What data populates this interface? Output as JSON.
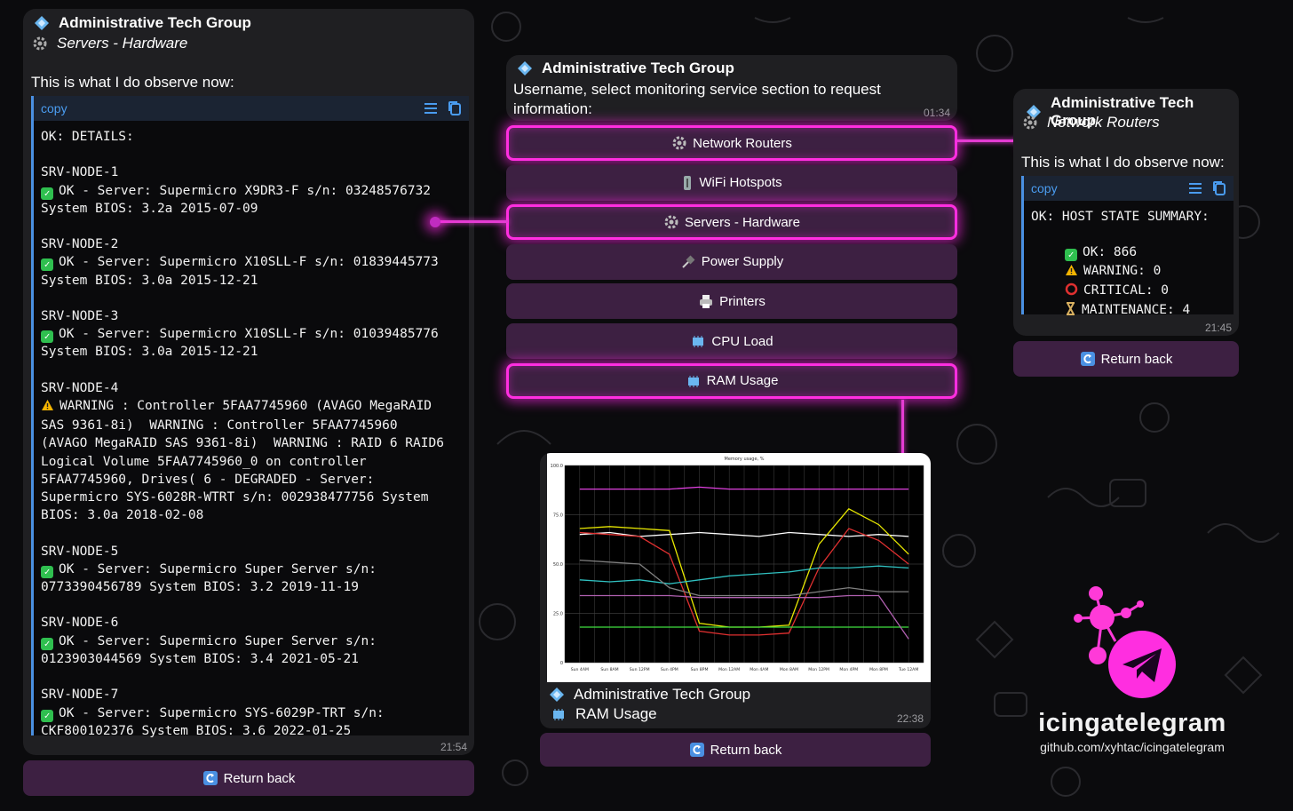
{
  "colors": {
    "accent_glow": "#ff2ee0",
    "keyboard_btn": "#3d2042",
    "bubble": "#1f1f22",
    "code_border": "#4a90e2",
    "check": "#2fbf4f"
  },
  "left_msg": {
    "group": "Administrative Tech Group",
    "section": "Servers - Hardware",
    "intro": "This is what I do observe now:",
    "code_copy": "copy",
    "lines": [
      {
        "t": "OK: DETAILS:"
      },
      {
        "t": ""
      },
      {
        "t": "SRV-NODE-1"
      },
      {
        "icon": "check",
        "t": "OK - Server: Supermicro X9DR3-F s/n: 03248576732"
      },
      {
        "t": "System BIOS: 3.2a 2015-07-09"
      },
      {
        "t": ""
      },
      {
        "t": "SRV-NODE-2"
      },
      {
        "icon": "check",
        "t": "OK - Server: Supermicro X10SLL-F s/n: 01839445773"
      },
      {
        "t": "System BIOS: 3.0a 2015-12-21"
      },
      {
        "t": ""
      },
      {
        "t": "SRV-NODE-3"
      },
      {
        "icon": "check",
        "t": "OK - Server: Supermicro X10SLL-F s/n: 01039485776"
      },
      {
        "t": "System BIOS: 3.0a 2015-12-21"
      },
      {
        "t": ""
      },
      {
        "t": "SRV-NODE-4"
      },
      {
        "icon": "warn",
        "t": "WARNING : Controller 5FAA7745960 (AVAGO MegaRAID"
      },
      {
        "t": "SAS 9361-8i)  WARNING : Controller 5FAA7745960"
      },
      {
        "t": "(AVAGO MegaRAID SAS 9361-8i)  WARNING : RAID 6 RAID6"
      },
      {
        "t": "Logical Volume 5FAA7745960_0 on controller"
      },
      {
        "t": "5FAA7745960, Drives( 6 - DEGRADED - Server:"
      },
      {
        "t": "Supermicro SYS-6028R-WTRT s/n: 002938477756 System"
      },
      {
        "t": "BIOS: 3.0a 2018-02-08"
      },
      {
        "t": ""
      },
      {
        "t": "SRV-NODE-5"
      },
      {
        "icon": "check",
        "t": "OK - Server: Supermicro Super Server s/n:"
      },
      {
        "t": "0773390456789 System BIOS: 3.2 2019-11-19"
      },
      {
        "t": ""
      },
      {
        "t": "SRV-NODE-6"
      },
      {
        "icon": "check",
        "t": "OK - Server: Supermicro Super Server s/n:"
      },
      {
        "t": "0123903044569 System BIOS: 3.4 2021-05-21"
      },
      {
        "t": ""
      },
      {
        "t": "SRV-NODE-7"
      },
      {
        "icon": "check",
        "t": "OK - Server: Supermicro SYS-6029P-TRT s/n:"
      },
      {
        "t": "CKF800102376 System BIOS: 3.6 2022-01-25"
      }
    ],
    "time": "21:54",
    "return_label": "Return back"
  },
  "center_msg": {
    "group": "Administrative Tech Group",
    "text": "Username, select monitoring service section to request information:",
    "time": "01:34",
    "buttons": [
      {
        "label": "Network Routers",
        "icon": "gear-icon",
        "glow": true
      },
      {
        "label": "WiFi Hotspots",
        "icon": "tower-icon",
        "glow": false
      },
      {
        "label": "Servers - Hardware",
        "icon": "gear-icon",
        "glow": true
      },
      {
        "label": "Power Supply",
        "icon": "plug-icon",
        "glow": false
      },
      {
        "label": "Printers",
        "icon": "printer-icon",
        "glow": false
      },
      {
        "label": "CPU Load",
        "icon": "chip-icon",
        "glow": false
      },
      {
        "label": "RAM Usage",
        "icon": "chip-icon",
        "glow": true
      }
    ]
  },
  "chart_msg": {
    "group": "Administrative Tech Group",
    "section": "RAM Usage",
    "time": "22:38",
    "return_label": "Return back"
  },
  "chart_data": {
    "type": "line",
    "title": "Memory usage, %",
    "ylim": [
      0,
      100
    ],
    "yticks": [
      "0",
      "25.0",
      "50.0",
      "75.0",
      "100.0"
    ],
    "x": [
      "Sun 4AM",
      "Sun 8AM",
      "Sun 12PM",
      "Sun 4PM",
      "Sun 8PM",
      "Mon 12AM",
      "Mon 4AM",
      "Mon 8AM",
      "Mon 12PM",
      "Mon 4PM",
      "Mon 8PM",
      "Tue 12AM"
    ],
    "series": [
      {
        "color": "#e040e0",
        "values": [
          88,
          88,
          88,
          88,
          89,
          88,
          88,
          88,
          88,
          88,
          88,
          88
        ]
      },
      {
        "color": "#ffffff",
        "values": [
          65,
          66,
          64,
          65,
          66,
          65,
          64,
          66,
          65,
          64,
          65,
          64
        ]
      },
      {
        "color": "#e8e800",
        "values": [
          68,
          69,
          68,
          67,
          20,
          18,
          18,
          19,
          60,
          78,
          70,
          55
        ]
      },
      {
        "color": "#e03030",
        "values": [
          66,
          65,
          64,
          55,
          16,
          14,
          14,
          15,
          48,
          68,
          62,
          50
        ]
      },
      {
        "color": "#30c0c0",
        "values": [
          42,
          41,
          42,
          40,
          42,
          44,
          45,
          46,
          48,
          48,
          49,
          48
        ]
      },
      {
        "color": "#808080",
        "values": [
          52,
          51,
          50,
          38,
          34,
          34,
          34,
          34,
          36,
          38,
          36,
          36
        ]
      },
      {
        "color": "#40e040",
        "values": [
          18,
          18,
          18,
          18,
          18,
          18,
          18,
          18,
          18,
          18,
          18,
          18
        ]
      },
      {
        "color": "#b060b0",
        "values": [
          34,
          34,
          34,
          34,
          33,
          33,
          33,
          33,
          33,
          34,
          34,
          12
        ]
      }
    ]
  },
  "right_msg": {
    "group": "Administrative Tech Group",
    "section": "Network Routers",
    "intro": "This is what I do observe now:",
    "code_copy": "copy",
    "header_line": "OK: HOST STATE SUMMARY:",
    "rows": [
      {
        "icon": "check",
        "t": "OK: 866"
      },
      {
        "icon": "warn",
        "t": "WARNING: 0"
      },
      {
        "icon": "circle",
        "t": "CRITICAL: 0"
      },
      {
        "icon": "hourglass",
        "t": "MAINTENANCE: 4"
      }
    ],
    "time": "21:45",
    "return_label": "Return back"
  },
  "brand": {
    "name": "icingatelegram",
    "url": "github.com/xyhtac/icingatelegram"
  }
}
